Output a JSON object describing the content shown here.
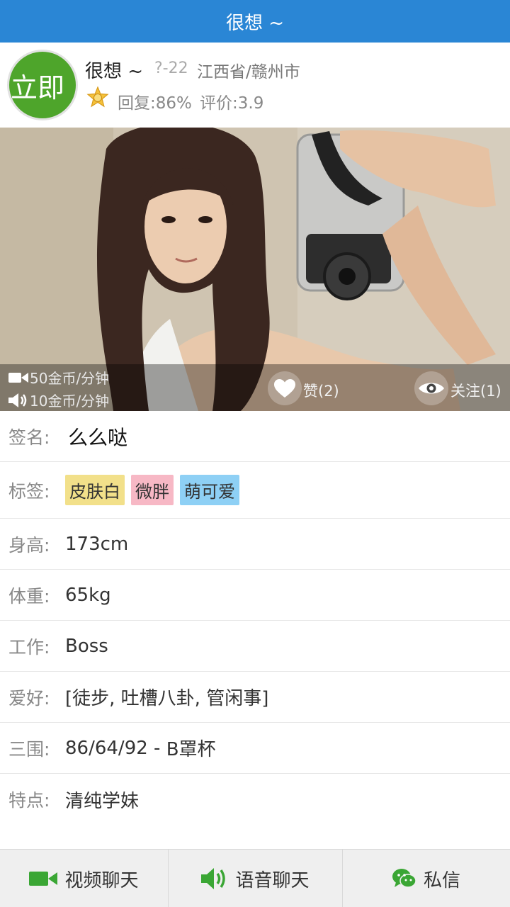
{
  "titlebar": {
    "title": "很想 ~"
  },
  "profile": {
    "avatar_text": "立即",
    "nickname": "很想 ~",
    "age": "?-22",
    "location": "江西省/赣州市",
    "reply_rate": "回复:86%",
    "rating": "评价:3.9"
  },
  "photo": {
    "video_price": "50金币/分钟",
    "voice_price": "10金币/分钟",
    "likes": "赞(2)",
    "follows": "关注(1)"
  },
  "details": {
    "signature_label": "签名:",
    "signature": "么么哒",
    "tags_label": "标签:",
    "tags": [
      {
        "text": "皮肤白",
        "color": "#f2e08a"
      },
      {
        "text": "微胖",
        "color": "#f7b8c5"
      },
      {
        "text": "萌可爱",
        "color": "#8ed0f5"
      }
    ],
    "height_label": "身高:",
    "height": "173cm",
    "weight_label": "体重:",
    "weight": "65kg",
    "job_label": "工作:",
    "job": "Boss",
    "hobby_label": "爱好:",
    "hobby": "[徒步, 吐槽八卦, 管闲事]",
    "measure_label": "三围:",
    "measure": "86/64/92 - ",
    "cup": "B罩杯",
    "feature_label": "特点:",
    "feature": "清纯学妹"
  },
  "bottombar": {
    "video_chat": "视频聊天",
    "voice_chat": "语音聊天",
    "message": "私信"
  },
  "colors": {
    "titlebar": "#2a86d5",
    "avatar": "#4ea52b",
    "icon_green": "#3aa634",
    "cup": "#e8735d"
  }
}
